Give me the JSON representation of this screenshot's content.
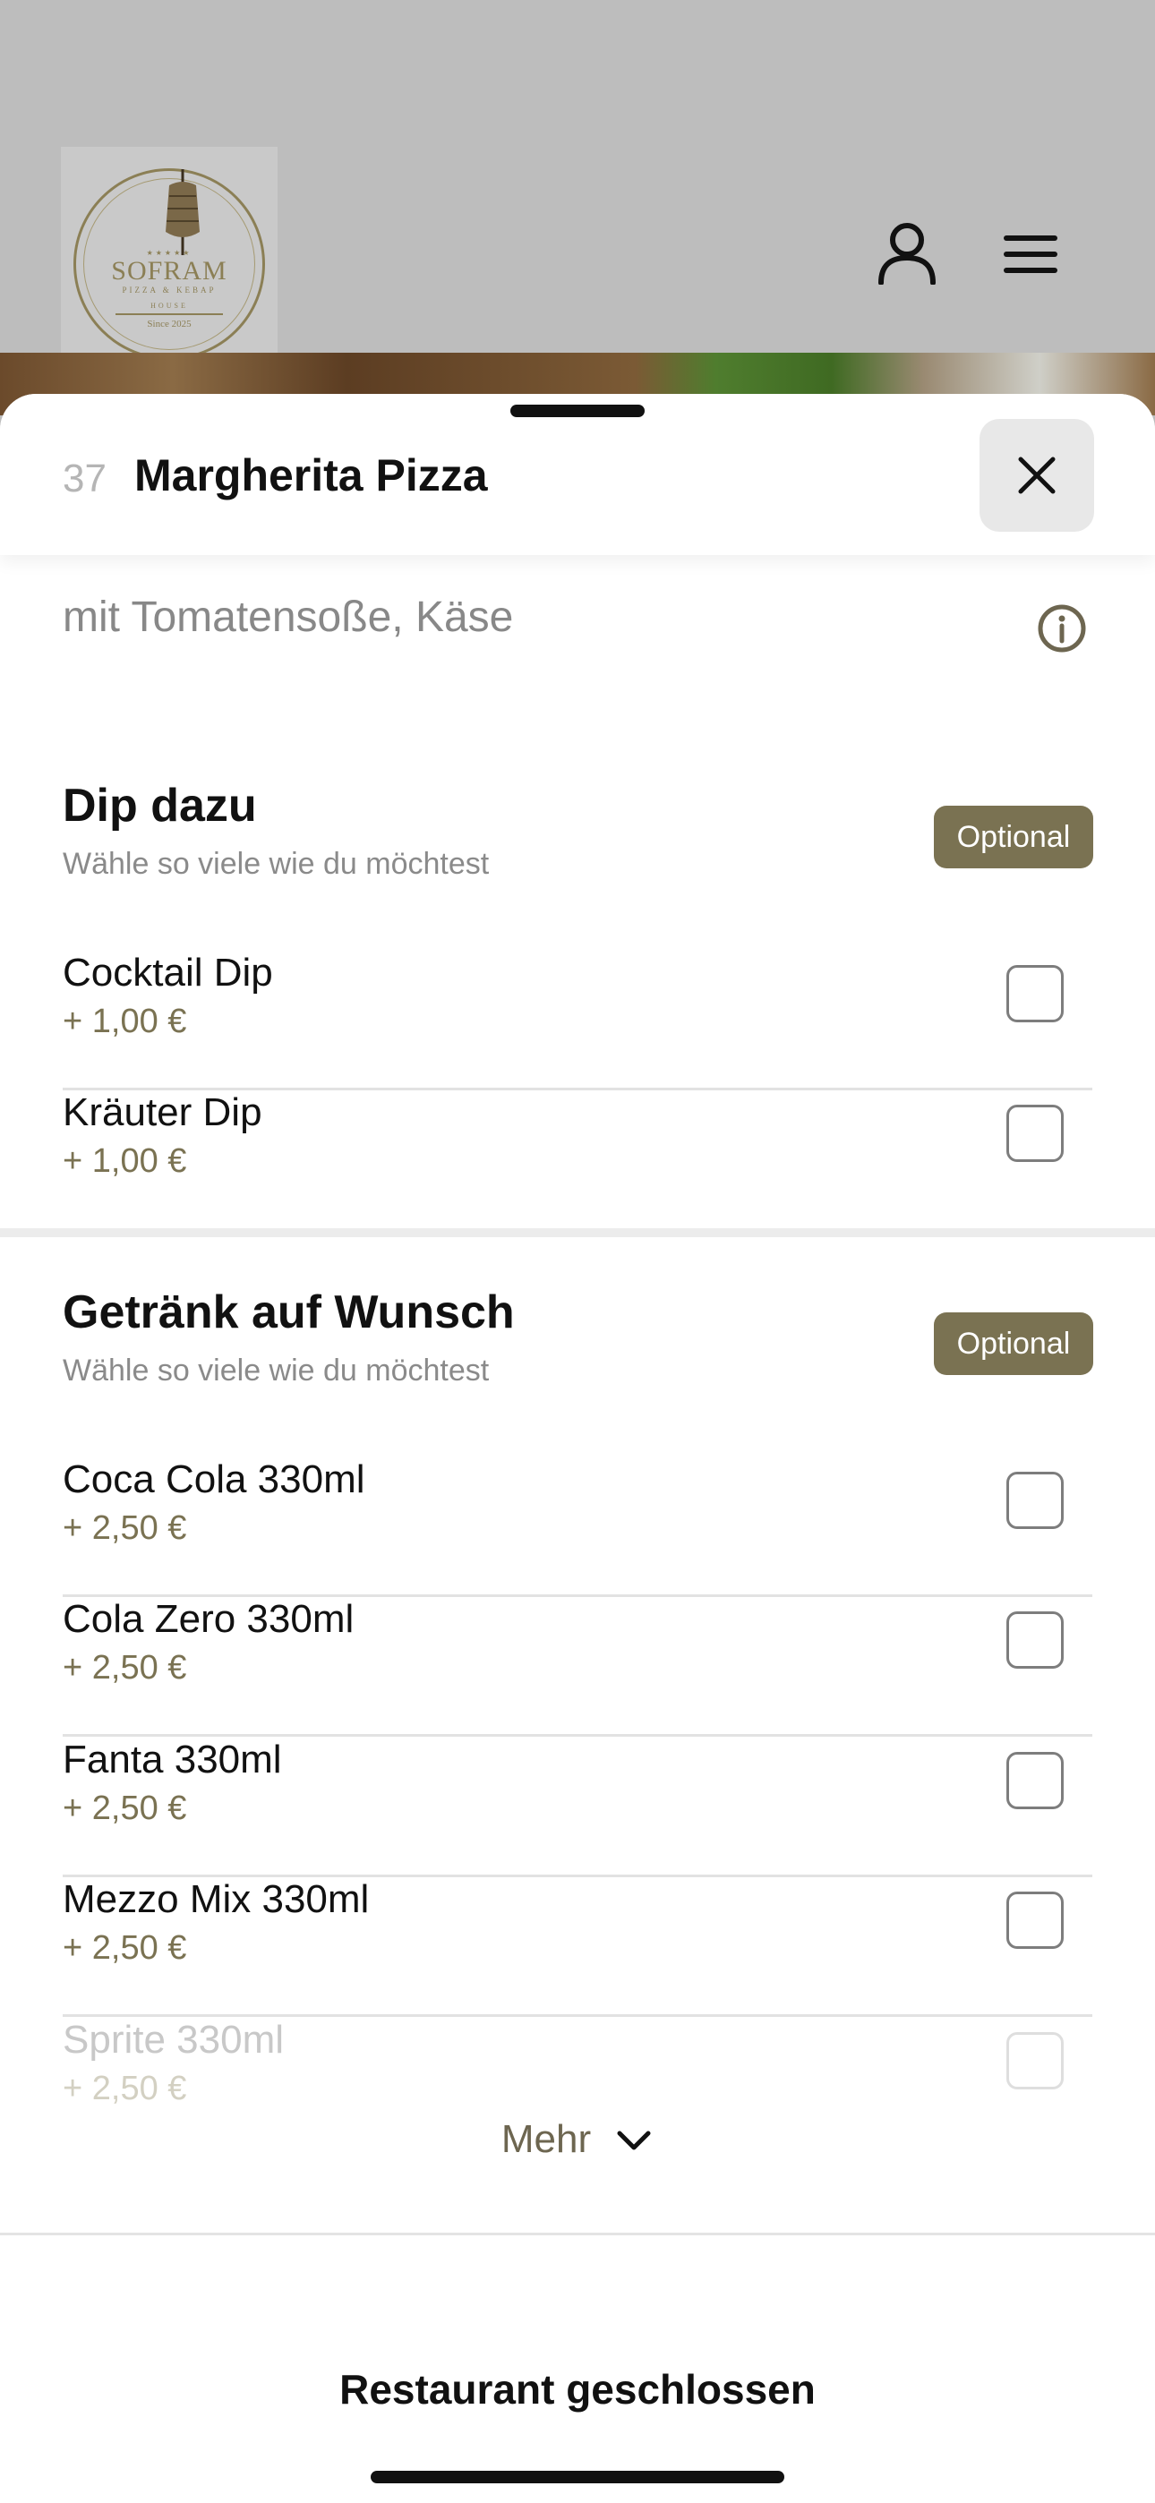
{
  "header": {
    "logo": {
      "name": "SOFRAM",
      "subtitle": "PIZZA & KEBAP",
      "house": "HOUSE",
      "since": "Since 2025",
      "stars": "★★★★★"
    },
    "icons": [
      "user-icon",
      "menu-icon"
    ]
  },
  "sheet": {
    "item_number": "37",
    "item_title": "Margherita Pizza",
    "description": "mit Tomatensoße, Käse",
    "groups": [
      {
        "title": "Dip dazu",
        "subtitle": "Wähle so viele wie du möchtest",
        "badge": "Optional",
        "options": [
          {
            "name": "Cocktail Dip",
            "price": "+ 1,00 €",
            "checked": false
          },
          {
            "name": "Kräuter Dip",
            "price": "+ 1,00 €",
            "checked": false
          }
        ]
      },
      {
        "title": "Getränk auf Wunsch",
        "subtitle": "Wähle so viele wie du möchtest",
        "badge": "Optional",
        "options": [
          {
            "name": "Coca Cola 330ml",
            "price": "+ 2,50 €",
            "checked": false
          },
          {
            "name": "Cola Zero 330ml",
            "price": "+ 2,50 €",
            "checked": false
          },
          {
            "name": "Fanta 330ml",
            "price": "+ 2,50 €",
            "checked": false
          },
          {
            "name": "Mezzo Mix 330ml",
            "price": "+ 2,50 €",
            "checked": false
          },
          {
            "name": "Sprite 330ml",
            "price": "+ 2,50 €",
            "checked": false
          }
        ]
      }
    ],
    "more_label": "Mehr",
    "footer_label": "Restaurant geschlossen"
  },
  "colors": {
    "accent": "#7a7252",
    "backdrop": "#bdbdbd"
  }
}
